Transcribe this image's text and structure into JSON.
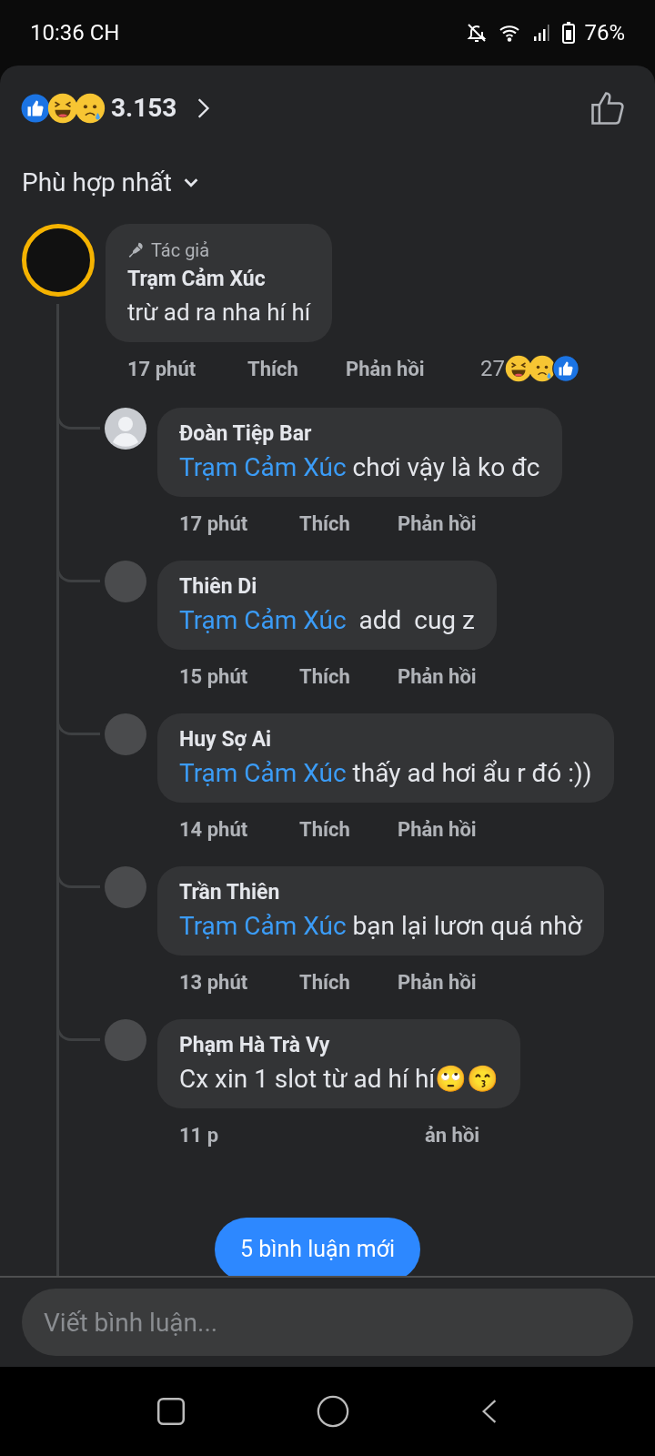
{
  "status_bar": {
    "time": "10:36 CH",
    "battery": "76%"
  },
  "header": {
    "reactions": [
      {
        "kind": "like"
      },
      {
        "kind": "haha"
      },
      {
        "kind": "sad"
      }
    ],
    "count": "3.153"
  },
  "sort": {
    "label": "Phù hợp nhất"
  },
  "comment": {
    "badge": "Tác giả",
    "name": "Trạm Cảm Xúc",
    "text": "trừ ad ra nha hí hí",
    "time": "17 phút",
    "like": "Thích",
    "reply": "Phản hồi",
    "reaction_count": "27",
    "reactions": [
      {
        "kind": "haha"
      },
      {
        "kind": "sad"
      },
      {
        "kind": "like"
      }
    ],
    "replies": [
      {
        "name": "Đoàn Tiệp Bar",
        "mention": "Trạm Cảm Xúc",
        "text": " chơi vậy là ko đc",
        "time": "17 phút",
        "like": "Thích",
        "reply": "Phản hồi",
        "kind": "silhouette"
      },
      {
        "name": "Thiên Di",
        "mention": "Trạm Cảm Xúc",
        "text": "  add  cug z",
        "time": "15 phút",
        "like": "Thích",
        "reply": "Phản hồi",
        "kind": "photo"
      },
      {
        "name": "Huy Sợ Ai",
        "mention": "Trạm Cảm Xúc",
        "text": " thấy ad hơi ẩu r đó :))",
        "time": "14 phút",
        "like": "Thích",
        "reply": "Phản hồi",
        "kind": "photo"
      },
      {
        "name": "Trần Thiên",
        "mention": "Trạm Cảm Xúc",
        "text": " bạn lại lươn quá nhờ",
        "time": "13 phút",
        "like": "Thích",
        "reply": "Phản hồi",
        "kind": "photo"
      },
      {
        "name": "Phạm Hà Trà Vy",
        "text": "Cx xin 1 slot từ ad hí hí🙄😙",
        "time": "11 p",
        "reply": "ản hồi",
        "kind": "photo"
      }
    ]
  },
  "new_comments_button": "5 bình luận mới",
  "composer": {
    "placeholder": "Viết bình luận..."
  }
}
